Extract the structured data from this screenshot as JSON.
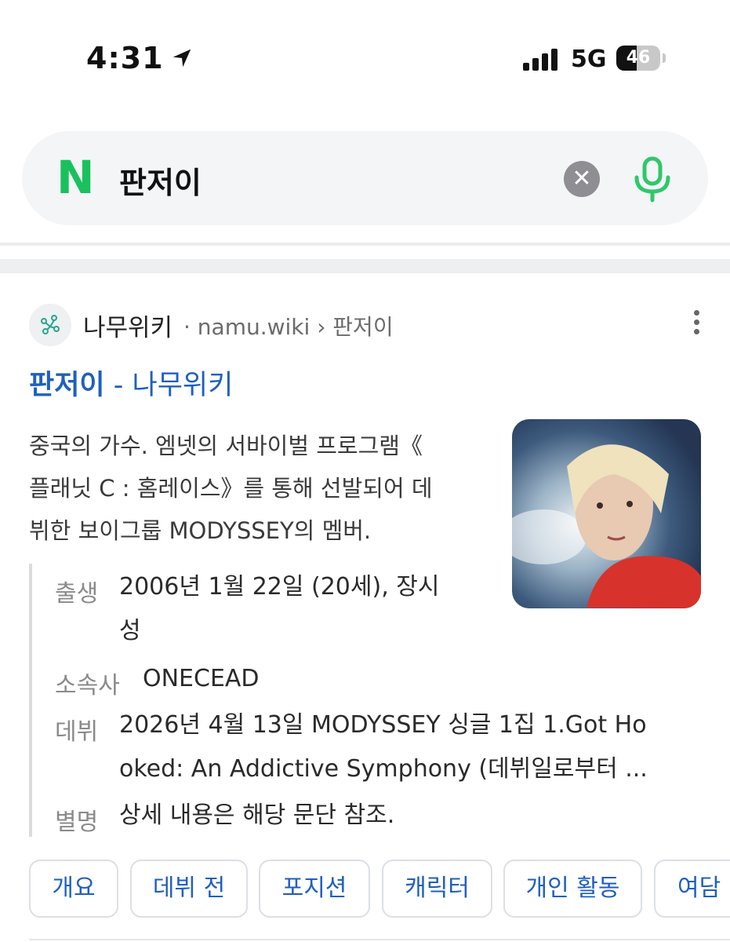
{
  "status_bar": {
    "time": "4:31",
    "network": "5G",
    "battery": "46",
    "battery_level": 0.46
  },
  "search": {
    "query": "판저이"
  },
  "result": {
    "site_name": "나무위키",
    "site_url": "· namu.wiki › 판저이",
    "title_main": "판저이",
    "title_suffix": " - 나무위키",
    "description_lines": [
      "중국의 가수. 엠넷의 서바이벌 프로그램《",
      "플래닛 C : 홈레이스》를 통해 선발되어 데",
      "뷔한 보이그룹 MODYSSEY의 멤버."
    ],
    "info": [
      {
        "key": "출생",
        "value_lines": [
          "2006년 1월 22일 (20세), 장시",
          "성"
        ]
      },
      {
        "key": "소속사",
        "value_lines": [
          "ONECEAD"
        ]
      },
      {
        "key": "데뷔",
        "value_lines": [
          "2026년 4월 13일 MODYSSEY 싱글 1집 1.Got Ho",
          "oked: An Addictive Symphony (데뷔일로부터 ..."
        ]
      },
      {
        "key": "별명",
        "value_lines": [
          "상세 내용은 해당 문단 참조."
        ]
      }
    ]
  },
  "chips": [
    "개요",
    "데뷔 전",
    "포지션",
    "캐릭터",
    "개인 활동",
    "여담"
  ],
  "colors": {
    "naver_green": "#19c15d",
    "link_blue": "#1f5fbf",
    "mic_green": "#2fc86a"
  }
}
